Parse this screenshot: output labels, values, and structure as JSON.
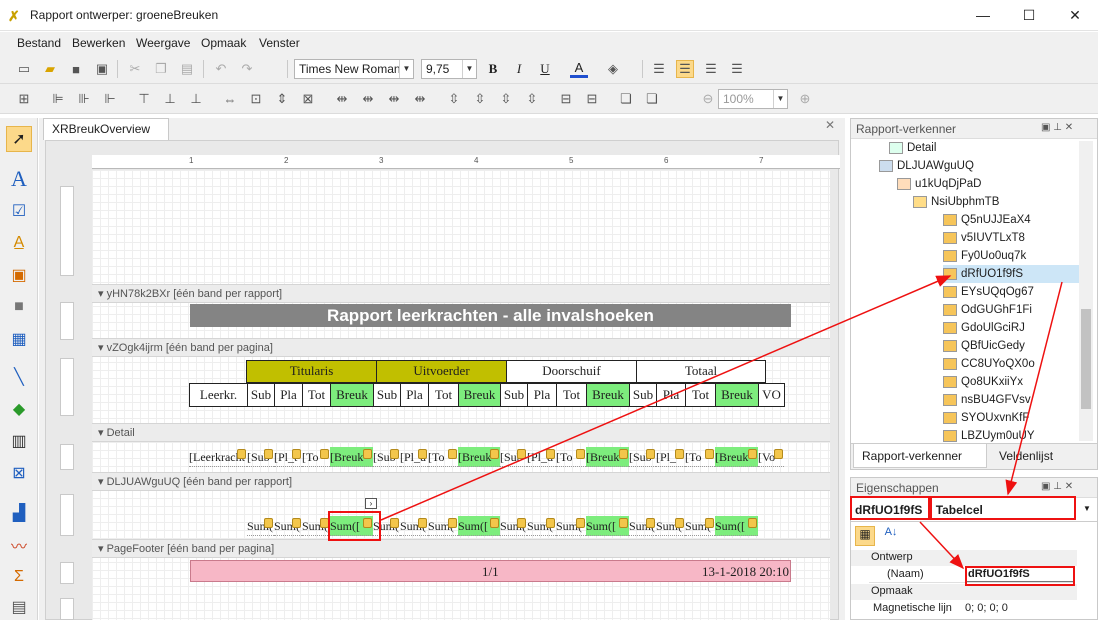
{
  "window": {
    "title": "Rapport ontwerper: groeneBreuken"
  },
  "menu": [
    "Bestand",
    "Bewerken",
    "Weergave",
    "Opmaak",
    "Venster"
  ],
  "toolbar": {
    "font": "Times New Roman",
    "size": "9,75",
    "zoom": "100%"
  },
  "document_tab": "XRBreukOverview",
  "bands": {
    "report_header": "yHN78k2BXr [één band per rapport]",
    "page_header": "vZOgk4ijrm [één band per pagina]",
    "detail": "Detail",
    "group_footer": "DLJUAWguUQ [één band per rapport]",
    "page_footer": "PageFooter [één band per pagina]"
  },
  "report": {
    "title": "Rapport leerkrachten - alle invalshoeken",
    "group_headers": [
      "Titularis",
      "Uitvoerder",
      "Doorschuif",
      "Totaal"
    ],
    "column_headers": [
      "Leerkr.",
      "Sub",
      "Pla",
      "Tot",
      "Breuk",
      "Sub",
      "Pla",
      "Tot",
      "Breuk",
      "Sub",
      "Pla",
      "Tot",
      "Breuk",
      "Sub",
      "Pla",
      "Tot",
      "Breuk",
      "VO"
    ],
    "detail_cells": [
      "[Leerkracht",
      "[Sub",
      "[Pl_t",
      "[To",
      "[Breuk",
      "[Sub",
      "[Pl_u",
      "[To",
      "[Breuk",
      "[Sub",
      "[Pl_d",
      "[To",
      "[Breuk",
      "[Sub",
      "[Pl_",
      "[To",
      "[Breuk",
      "[Vo"
    ],
    "sum_cells": [
      "Sum(",
      "Sum(",
      "Sum(",
      "Sum([",
      "Sum(",
      "Sum(",
      "Sum(",
      "Sum([",
      "Sum(",
      "Sum(",
      "Sum(",
      "Sum([",
      "Sum(",
      "Sum(",
      "Sum(",
      "Sum(["
    ],
    "footer_page": "1/1",
    "footer_date": "13-1-2018 20:10"
  },
  "explorer": {
    "title": "Rapport-verkenner",
    "items": [
      "Detail",
      "DLJUAWguUQ",
      "u1kUqDjPaD",
      "NsiUbphmTB",
      "Q5nUJJEaX4",
      "v5IUVTLxT8",
      "Fy0Uo0uq7k",
      "dRfUO1f9fS",
      "EYsUQqOg67",
      "OdGUGhF1Fi",
      "GdoUlGciRJ",
      "QBfUicGedy",
      "CC8UYoQX0o",
      "Qo8UKxiiYx",
      "nsBU4GFVsv",
      "SYOUxvnKfF",
      "LBZUym0uUY"
    ],
    "tabs": [
      "Rapport-verkenner",
      "Veldenlijst"
    ]
  },
  "properties": {
    "title": "Eigenschappen",
    "selected_name": "dRfUO1f9fS",
    "selected_type": "Tabelcel",
    "sections": [
      "Ontwerp",
      "Opmaak"
    ],
    "rows": [
      {
        "label": "(Naam)",
        "value": "dRfUO1f9fS"
      },
      {
        "label": "Magnetische lijn",
        "value": "0; 0; 0; 0"
      }
    ]
  },
  "colors": {
    "accent_red": "#e11",
    "olive": "#c1bf00",
    "green": "#7ded7d",
    "footer_pink": "#f7b7c6"
  }
}
